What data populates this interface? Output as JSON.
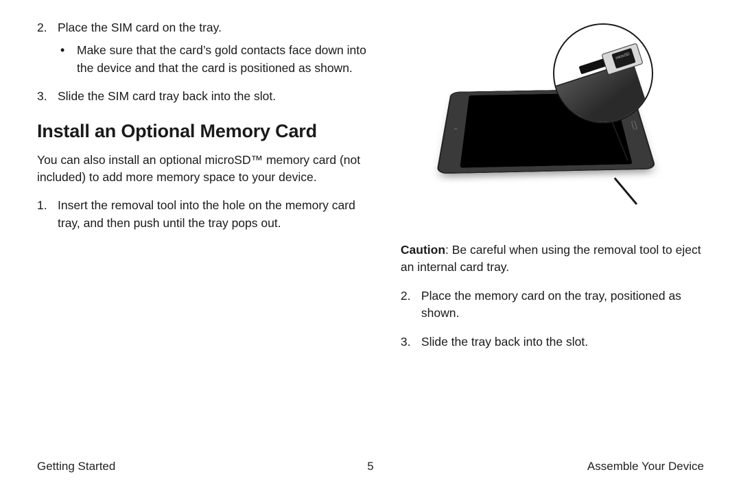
{
  "left": {
    "step2": {
      "marker": "2.",
      "text": "Place the SIM card on the tray."
    },
    "step2_bullet": {
      "bullet": "•",
      "text": "Make sure that the card’s gold contacts face down into the device and that the card is positioned as shown."
    },
    "step3": {
      "marker": "3.",
      "text": "Slide the SIM card tray back into the slot."
    },
    "heading": "Install an Optional Memory Card",
    "intro": "You can also install an optional microSD™ memory card (not included) to add more memory space to your device.",
    "mem1": {
      "marker": "1.",
      "text": "Insert the removal tool into the hole on the memory card tray, and then push until the tray pops out."
    }
  },
  "right": {
    "caution_label": "Caution",
    "caution_text": ": Be careful when using the removal tool to eject an internal card tray.",
    "mem2": {
      "marker": "2.",
      "text": "Place the memory card on the tray, positioned as shown."
    },
    "mem3": {
      "marker": "3.",
      "text": "Slide the tray back into the slot."
    },
    "card_label": "microSD"
  },
  "footer": {
    "left": "Getting Started",
    "center": "5",
    "right": "Assemble Your Device"
  }
}
